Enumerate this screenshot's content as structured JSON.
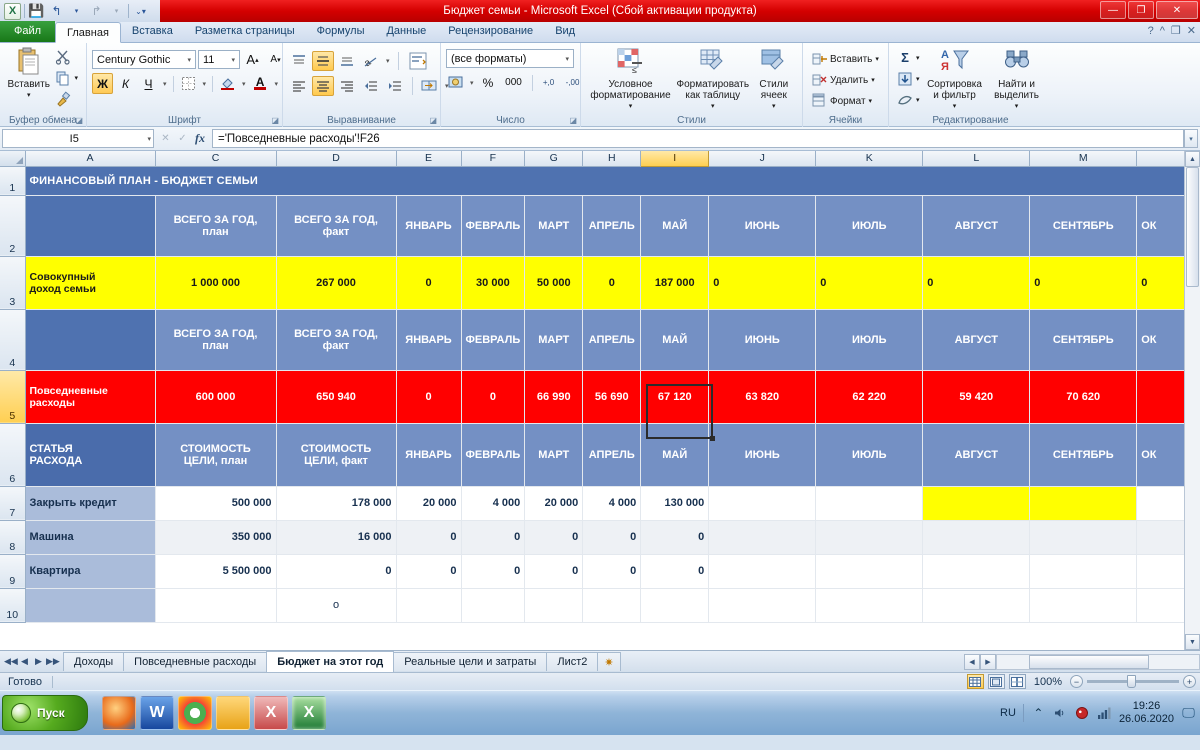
{
  "window": {
    "title": "Бюджет семьи  -  Microsoft Excel (Сбой активации продукта)",
    "minimize": "—",
    "restore": "❐",
    "close": "✕",
    "qat": {
      "logo": "X",
      "save": "save-icon",
      "undo": "undo-icon",
      "redo": "redo-icon",
      "more": "more-icon"
    }
  },
  "tabs": [
    {
      "label": "Файл",
      "kind": "file"
    },
    {
      "label": "Главная",
      "kind": "active"
    },
    {
      "label": "Вставка",
      "kind": "normal"
    },
    {
      "label": "Разметка страницы",
      "kind": "normal"
    },
    {
      "label": "Формулы",
      "kind": "normal"
    },
    {
      "label": "Данные",
      "kind": "normal"
    },
    {
      "label": "Рецензирование",
      "kind": "normal"
    },
    {
      "label": "Вид",
      "kind": "normal"
    }
  ],
  "ribbon": {
    "clipboard": {
      "group_label": "Буфер обмена",
      "paste": "Вставить",
      "cut": "✂",
      "copy": "⧉",
      "format_painter": "🖌",
      "dialog": "◪"
    },
    "font": {
      "group_label": "Шрифт",
      "font_name": "Century Gothic",
      "font_size": "11",
      "grow": "A",
      "shrink": "A",
      "bold": "Ж",
      "italic": "К",
      "underline": "Ч",
      "borders": "▦",
      "fill": "A",
      "color": "A",
      "dialog": "◪"
    },
    "alignment": {
      "group_label": "Выравнивание",
      "align_top": "top-align-icon",
      "align_middle": "middle-align-icon",
      "align_bottom": "bottom-align-icon",
      "orientation": "orientation-icon",
      "wrap_text": "wrap-text-icon",
      "align_left": "align-left-icon",
      "align_center": "align-center-icon",
      "align_right": "align-right-icon",
      "decrease_indent": "decrease-indent-icon",
      "increase_indent": "increase-indent-icon",
      "merge_cells": "merge-cells-icon",
      "dialog": "◪"
    },
    "number": {
      "group_label": "Число",
      "format": "(все форматы)",
      "accounting": "currency-icon",
      "percent": "%",
      "comma": "000",
      "increase_decimal": "+,0",
      "decrease_decimal": "-,00",
      "dialog": "◪"
    },
    "styles": {
      "group_label": "Стили",
      "conditional": "Условное\nформатирование",
      "as_table": "Форматировать\nкак таблицу",
      "cell_styles": "Стили\nячеек"
    },
    "cells": {
      "group_label": "Ячейки",
      "insert": "Вставить",
      "delete": "Удалить",
      "format": "Формат"
    },
    "editing": {
      "group_label": "Редактирование",
      "autosum": "Σ",
      "fill": "▼",
      "clear": "◇",
      "sort_filter": "Сортировка\nи фильтр",
      "find_select": "Найти и\nвыделить"
    },
    "right_icons": {
      "help": "?",
      "minimize_ribbon": "^",
      "restore_ribbon": "❐",
      "close_doc": "✕"
    }
  },
  "formula_bar": {
    "name_box": "I5",
    "cancel": "✕",
    "enter": "✓",
    "fx": "fx",
    "formula": "='Повседневные расходы'!F26"
  },
  "grid": {
    "columns": [
      "A",
      "C",
      "D",
      "E",
      "F",
      "G",
      "H",
      "I",
      "J",
      "K",
      "L",
      "M"
    ],
    "selected_column": "I",
    "selected_row": "5",
    "row_numbers": [
      "1",
      "2",
      "3",
      "4",
      "5",
      "6",
      "7",
      "8",
      "9",
      "10"
    ],
    "rows": {
      "r1": {
        "title": "ФИНАНСОВЫЙ ПЛАН - БЮДЖЕТ СЕМЬИ"
      },
      "r2": [
        "",
        "ВСЕГО ЗА ГОД,\nплан",
        "ВСЕГО ЗА ГОД,\nфакт",
        "ЯНВАРЬ",
        "ФЕВРАЛЬ",
        "МАРТ",
        "АПРЕЛЬ",
        "МАЙ",
        "ИЮНЬ",
        "ИЮЛЬ",
        "АВГУСТ",
        "СЕНТЯБРЬ",
        "ОК"
      ],
      "r3": [
        "Совокупный\nдоход семьи",
        "1 000 000",
        "267 000",
        "0",
        "30 000",
        "50 000",
        "0",
        "187 000",
        "0",
        "0",
        "0",
        "0",
        "0"
      ],
      "r4": [
        "",
        "ВСЕГО ЗА ГОД,\nплан",
        "ВСЕГО ЗА ГОД,\nфакт",
        "ЯНВАРЬ",
        "ФЕВРАЛЬ",
        "МАРТ",
        "АПРЕЛЬ",
        "МАЙ",
        "ИЮНЬ",
        "ИЮЛЬ",
        "АВГУСТ",
        "СЕНТЯБРЬ",
        "ОК"
      ],
      "r5": [
        "Повседневные\nрасходы",
        "600 000",
        "650 940",
        "0",
        "0",
        "66 990",
        "56 690",
        "67 120",
        "63 820",
        "62 220",
        "59 420",
        "70 620",
        ""
      ],
      "r6": [
        "СТАТЬЯ\nРАСХОДА",
        "СТОИМОСТЬ\nЦЕЛИ, план",
        "СТОИМОСТЬ\nЦЕЛИ, факт",
        "ЯНВАРЬ",
        "ФЕВРАЛЬ",
        "МАРТ",
        "АПРЕЛЬ",
        "МАЙ",
        "ИЮНЬ",
        "ИЮЛЬ",
        "АВГУСТ",
        "СЕНТЯБРЬ",
        "ОК"
      ],
      "r7": [
        "Закрыть кредит",
        "500 000",
        "178 000",
        "20 000",
        "4 000",
        "20 000",
        "4 000",
        "130 000",
        "",
        "",
        "",
        "",
        ""
      ],
      "r8": [
        "Машина",
        "350 000",
        "16 000",
        "0",
        "0",
        "0",
        "0",
        "0",
        "",
        "",
        "",
        "",
        ""
      ],
      "r9": [
        "Квартира",
        "5 500 000",
        "0",
        "0",
        "0",
        "0",
        "0",
        "0",
        "",
        "",
        "",
        "",
        ""
      ],
      "r10": [
        "",
        "",
        "о",
        "",
        "",
        "",
        "",
        "",
        "",
        "",
        "",
        "",
        ""
      ]
    }
  },
  "sheets": {
    "nav": {
      "first": "◀◀",
      "prev": "◀",
      "next": "▶",
      "last": "▶▶"
    },
    "items": [
      {
        "label": "Доходы",
        "active": false
      },
      {
        "label": "Повседневные расходы",
        "active": false
      },
      {
        "label": "Бюджет на этот год",
        "active": true
      },
      {
        "label": "Реальные цели и затраты",
        "active": false
      },
      {
        "label": "Лист2",
        "active": false
      }
    ],
    "add_sheet": "✷"
  },
  "status": {
    "mode": "Готово",
    "view_normal": "normal-view-icon",
    "view_layout": "page-layout-icon",
    "view_break": "page-break-icon",
    "zoom": "100%",
    "zoom_out": "−",
    "zoom_in": "+"
  },
  "taskbar": {
    "start": "Пуск",
    "items": [
      {
        "name": "firefox-icon",
        "glyph": "🦊"
      },
      {
        "name": "word-icon",
        "glyph": "W"
      },
      {
        "name": "chrome-icon",
        "glyph": "◉"
      },
      {
        "name": "explorer-icon",
        "glyph": "🗀"
      },
      {
        "name": "excel-doc-icon",
        "glyph": "X"
      },
      {
        "name": "excel-active-icon",
        "glyph": "X"
      }
    ],
    "tray": {
      "language": "RU",
      "show_hidden": "⌃",
      "volume": "🔊",
      "antivirus": "◈",
      "network": "▂▄▆",
      "time": "19:26",
      "date": "26.06.2020",
      "show_desktop": "▭"
    }
  },
  "colors": {
    "title_red": "#d40000",
    "header_blue": "#7490c4",
    "header_blue_dark": "#4f72b0",
    "income_yellow": "#ffff00",
    "expense_red": "#ff0000",
    "row_label_blue": "#aabcda"
  }
}
